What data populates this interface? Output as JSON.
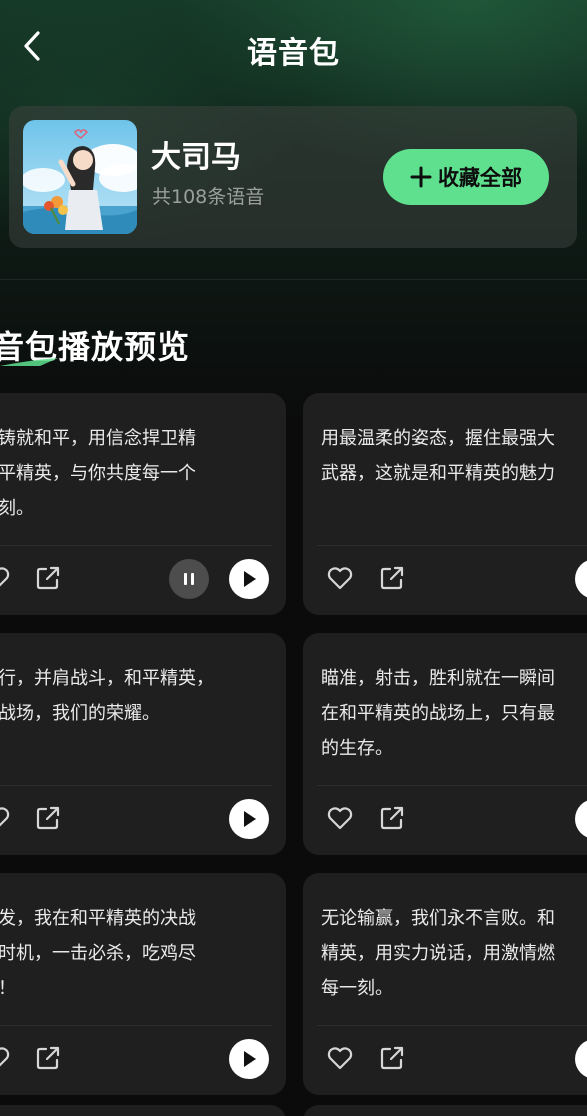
{
  "header": {
    "title": "语音包"
  },
  "pack": {
    "name": "大司马",
    "count_text": "共108条语音",
    "favorite_all_label": "收藏全部"
  },
  "section": {
    "title": "音包播放预览"
  },
  "voices": [
    {
      "text": "热血铸就和平，用信念捍卫精\n，和平精英，与你共度每一个\n战时刻。",
      "state": "playing"
    },
    {
      "text": "用最温柔的姿态，握住最强大\n武器，这就是和平精英的魅力",
      "state": "idle"
    },
    {
      "text": "手同行，并肩战斗，和平精英，\n们的战场，我们的荣耀。",
      "state": "idle"
    },
    {
      "text": "瞄准，射击，胜利就在一瞬间\n在和平精英的战场上，只有最\n的生存。",
      "state": "idle"
    },
    {
      "text": "钧一发，我在和平精英的决战\n抓住时机，一击必杀，吃鸡尽\n掌控！",
      "state": "idle"
    },
    {
      "text": "无论输赢，我们永不言败。和\n精英，用实力说话，用激情燃\n每一刻。",
      "state": "idle"
    }
  ],
  "colors": {
    "accent": "#5fe08e",
    "card_bg": "#1f1f1f",
    "page_bg": "#0b0b0b"
  },
  "icons": [
    "back-arrow-icon",
    "plus-icon",
    "heart-icon",
    "share-icon",
    "play-icon",
    "pause-icon"
  ]
}
